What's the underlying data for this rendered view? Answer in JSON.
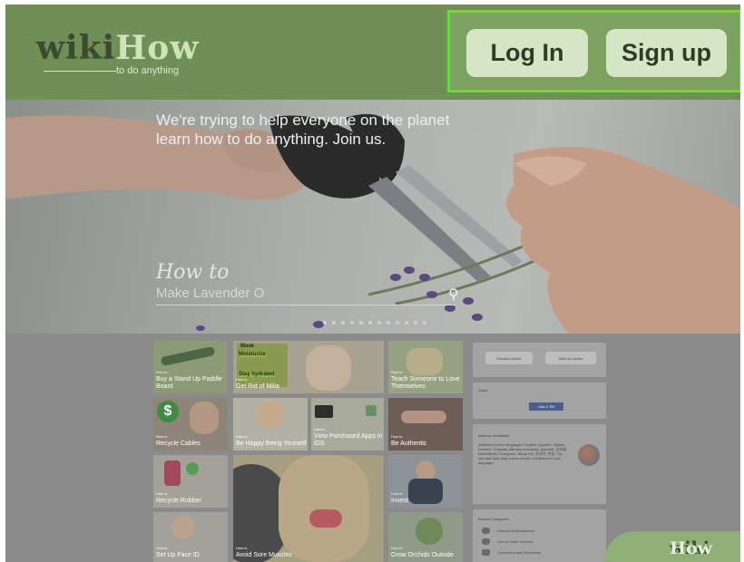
{
  "header": {
    "logo_wiki": "wiki",
    "logo_how": "How",
    "tagline": "to do anything",
    "login_label": "Log In",
    "signup_label": "Sign up"
  },
  "hero": {
    "headline_line1": "We're trying to help everyone on the planet",
    "headline_line2": "learn how to do anything. Join us.",
    "how_to": "How to",
    "article": "Make Lavender O"
  },
  "tiles": [
    {
      "label_small": "How to",
      "label": "Buy a Stand Up Paddle Board"
    },
    {
      "label_small": "How to",
      "label": "Get Rid of Milia"
    },
    {
      "label_small": "How to",
      "label": "Teach Someone to Love Themselves"
    },
    {
      "label_small": "How to",
      "label": "Recycle Cables"
    },
    {
      "label_small": "How to",
      "label": "Be Happy Being Yourself"
    },
    {
      "label_small": "How to",
      "label": "View Purchased Apps in iOS"
    },
    {
      "label_small": "How to",
      "label": "Be Authentic"
    },
    {
      "label_small": "How to",
      "label": "Recycle Rubber"
    },
    {
      "label_small": "How to",
      "label": "Invest"
    },
    {
      "label_small": "How to",
      "label": "Set Up Face ID"
    },
    {
      "label_small": "How to",
      "label": "Avoid Sore Muscles"
    },
    {
      "label_small": "How to",
      "label": "Grow Orchids Outside"
    }
  ],
  "tile_overlay": {
    "mask": "Mask",
    "moisturize": "Moisturize",
    "stay_hydrated": "Stay hydrated",
    "dollar": "$"
  },
  "sidebar": {
    "random_article": "Random Article",
    "write_article": "Write An Article",
    "share_title": "Share",
    "like_button": "Like 1.7M",
    "worldwide_title": "wikiHow Worldwide",
    "worldwide_text": "wikiHow in other languages: English, español, Italiano, Deutsch, Français, Bahasa Indonesia, русский, 日本語, Nederlands, Português, Tiếng Việt, 한국어, 中文. You can also help start a new version of wikiHow in your language.",
    "categories_title": "Browse Categories",
    "categories": [
      "Arts and Entertainment",
      "Cars & Other Vehicles",
      "Computers and Electronics"
    ]
  },
  "watermark": {
    "wiki": "wiki",
    "how": "How"
  },
  "colors": {
    "header_bg": "#6f8f57",
    "highlight_border": "#5ee23b",
    "button_bg": "#d6e6c5"
  }
}
